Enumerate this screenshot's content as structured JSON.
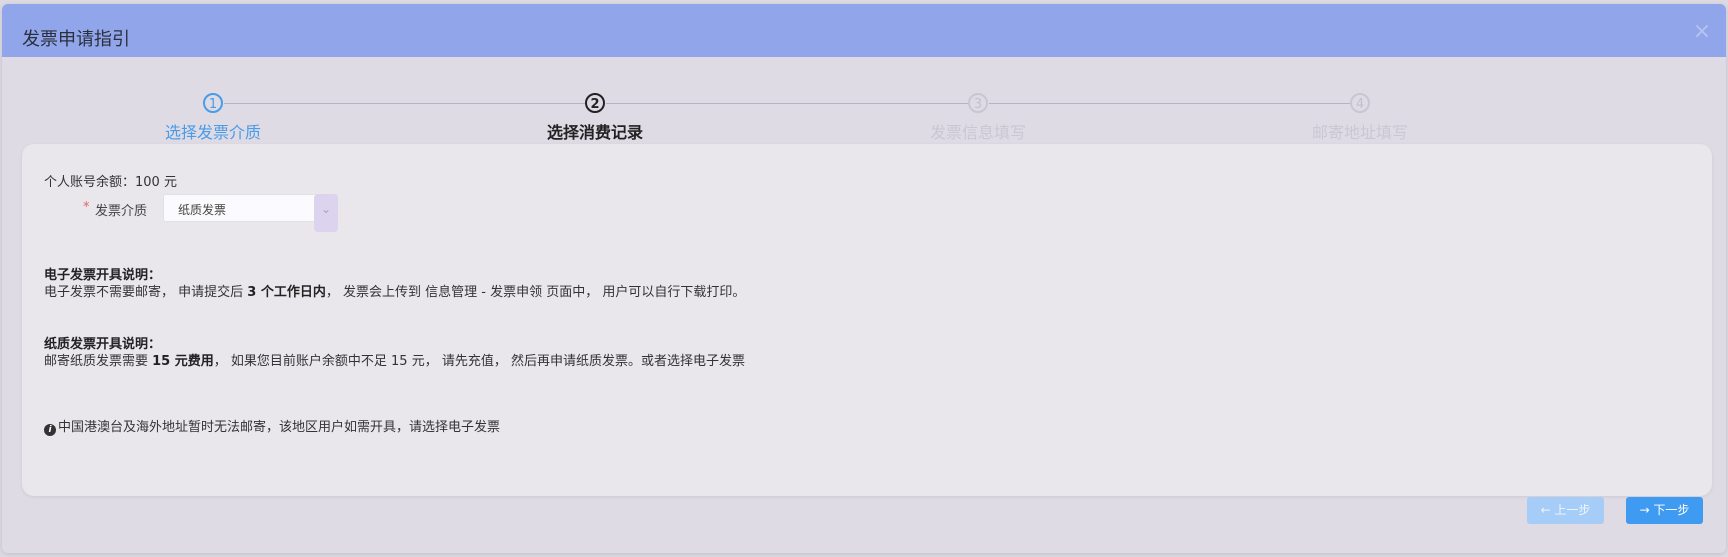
{
  "dialog": {
    "title": "发票申请指引",
    "close_icon": "×"
  },
  "steps": [
    {
      "number": "1",
      "label": "选择发票介质",
      "state": "done"
    },
    {
      "number": "2",
      "label": "选择消费记录",
      "state": "active"
    },
    {
      "number": "3",
      "label": "发票信息填写",
      "state": "pending"
    },
    {
      "number": "4",
      "label": "邮寄地址填写",
      "state": "pending"
    }
  ],
  "form": {
    "balance": "个人账号余额：100 元",
    "medium_label": "发票介质",
    "required_mark": "*",
    "medium_value": "纸质发票",
    "dropdown_icon": "⌄"
  },
  "electronic": {
    "title": "电子发票开具说明：",
    "text_a": "电子发票不需要邮寄， 申请提交后 ",
    "text_bold": "3 个工作日内",
    "text_b": "， 发票会上传到 信息管理 - 发票申领 页面中， 用户可以自行下载打印。"
  },
  "paper": {
    "title": "纸质发票开具说明：",
    "text_a": "邮寄纸质发票需要 ",
    "text_bold": "15 元费用",
    "text_b": "， 如果您目前账户余额中不足 15 元， 请先充值， 然后再申请纸质发票。或者选择电子发票"
  },
  "notice": {
    "icon": "i",
    "text": "中国港澳台及海外地址暂时无法邮寄，该地区用户如需开具，请选择电子发票"
  },
  "buttons": {
    "prev": "← 上一步",
    "next": "→ 下一步"
  },
  "colors": {
    "header": "#91a5ea",
    "primary": "#3f9bf2",
    "primary_disabled": "#a6cdf7",
    "step_done": "#4a9be8"
  }
}
